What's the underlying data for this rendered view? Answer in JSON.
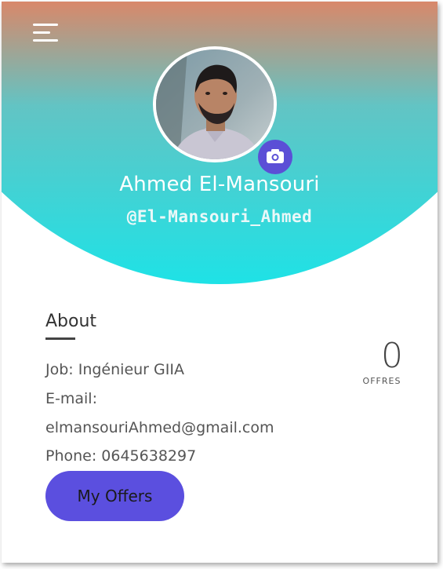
{
  "header": {
    "menu_icon": "hamburger-menu-icon",
    "camera_icon": "camera-icon",
    "name": "Ahmed El-Mansouri",
    "handle": "@El-Mansouri_Ahmed"
  },
  "about": {
    "title": "About",
    "job": "Job: Ingénieur GIIA",
    "email_label": "E-mail:",
    "email_value": "elmansouriAhmed@gmail.com",
    "phone": "Phone: 0645638297"
  },
  "stats": {
    "offers_count": "0",
    "offers_label": "OFFRES"
  },
  "actions": {
    "my_offers_label": "My Offers"
  },
  "colors": {
    "header_top": "#f47a55",
    "header_bottom": "#1ee2e6",
    "accent": "#5b4fdf"
  }
}
